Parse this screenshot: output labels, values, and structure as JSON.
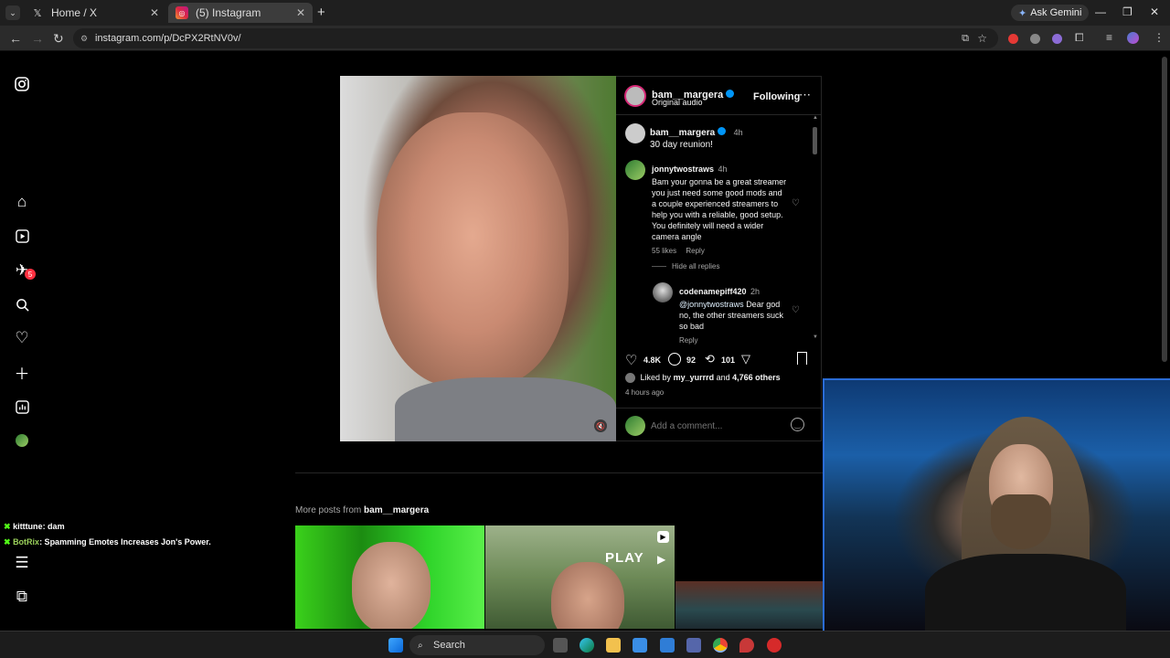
{
  "browser": {
    "tabs": [
      {
        "title": "Home / X",
        "favicon": "x-logo-icon"
      },
      {
        "title": "(5) Instagram",
        "favicon": "instagram-icon"
      }
    ],
    "ask_gemini": "Ask Gemini",
    "url": "instagram.com/p/DcPX2RtNV0v/"
  },
  "post": {
    "author": "bam__margera",
    "audio": "Original audio",
    "following": "Following",
    "caption_user": "bam__margera",
    "caption_time": "4h",
    "caption_text": "30 day reunion!",
    "comments": [
      {
        "user": "jonnytwostraws",
        "time": "4h",
        "text": "Bam your gonna be a great streamer you just need some good mods and a couple experienced streamers to help you with a reliable, good setup. You definitely will need a wider camera angle",
        "likes": "55 likes",
        "reply": "Reply"
      }
    ],
    "hide_replies": "Hide all replies",
    "reply": {
      "user": "codenamepiff420",
      "time": "2h",
      "mention": "@jonnytwostraws",
      "text": "Dear god no, the other streamers suck so bad",
      "reply": "Reply"
    },
    "like_count": "4.8K",
    "comment_count": "92",
    "repost_count": "101",
    "liked_by_prefix": "Liked by",
    "liked_by_user": "my_yurrrd",
    "liked_by_and": "and",
    "liked_by_others": "4,766 others",
    "timestamp": "4 hours ago",
    "add_comment_placeholder": "Add a comment..."
  },
  "more_posts": {
    "label": "More posts from",
    "user": "bam__margera",
    "play_label": "PLAY"
  },
  "chat": [
    {
      "name": "kitttune",
      "message": ": dam"
    },
    {
      "name": "BotRix",
      "message": ": Spamming Emotes Increases Jon's Power."
    }
  ],
  "nav": {
    "notification_badge": "5"
  },
  "taskbar": {
    "search": "Search"
  }
}
